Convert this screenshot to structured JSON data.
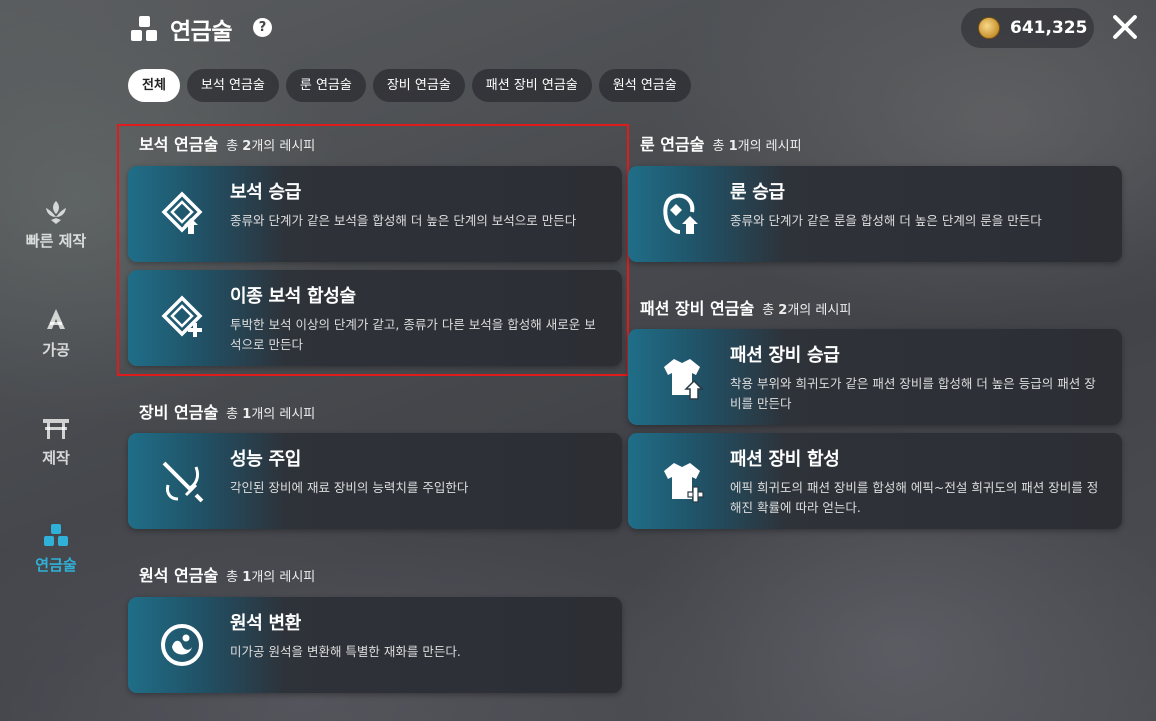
{
  "header": {
    "title": "연금술",
    "help": "?",
    "currency_value": "641,325"
  },
  "tabs": [
    {
      "label": "전체",
      "active": true
    },
    {
      "label": "보석 연금술"
    },
    {
      "label": "룬 연금술"
    },
    {
      "label": "장비 연금술"
    },
    {
      "label": "패션 장비 연금술"
    },
    {
      "label": "원석 연금술"
    }
  ],
  "sidebar": [
    {
      "label": "빠른 제작",
      "icon": "lotus-icon"
    },
    {
      "label": "가공",
      "icon": "anvil-icon"
    },
    {
      "label": "제작",
      "icon": "workbench-icon"
    },
    {
      "label": "연금술",
      "icon": "alchemy-icon",
      "active": true
    }
  ],
  "sections": {
    "gem": {
      "title": "보석 연금술",
      "count_prefix": "총",
      "count_num": "2",
      "count_suffix": "개의 레시피",
      "cards": [
        {
          "title": "보석 승급",
          "desc": "종류와 단계가 같은 보석을 합성해 더 높은 단계의 보석으로 만든다",
          "icon": "gem-upgrade-icon"
        },
        {
          "title": "이종 보석 합성술",
          "desc": "투박한 보석 이상의 단계가 같고, 종류가 다른 보석을 합성해 새로운 보석으로 만든다",
          "icon": "gem-combine-icon"
        }
      ]
    },
    "rune": {
      "title": "룬 연금술",
      "count_prefix": "총",
      "count_num": "1",
      "count_suffix": "개의 레시피",
      "cards": [
        {
          "title": "룬 승급",
          "desc": "종류와 단계가 같은 룬을 합성해 더 높은 단계의 룬을 만든다",
          "icon": "rune-upgrade-icon"
        }
      ]
    },
    "fashion": {
      "title": "패션 장비 연금술",
      "count_prefix": "총",
      "count_num": "2",
      "count_suffix": "개의 레시피",
      "cards": [
        {
          "title": "패션 장비 승급",
          "desc": "착용 부위와 희귀도가 같은 패션 장비를 합성해 더 높은 등급의 패션 장비를 만든다",
          "icon": "fashion-upgrade-icon"
        },
        {
          "title": "패션 장비 합성",
          "desc": "에픽 희귀도의 패션 장비를 합성해 에픽~전설 희귀도의 패션 장비를 정해진 확률에 따라 얻는다.",
          "icon": "fashion-combine-icon"
        }
      ]
    },
    "equip": {
      "title": "장비 연금술",
      "count_prefix": "총",
      "count_num": "1",
      "count_suffix": "개의 레시피",
      "cards": [
        {
          "title": "성능 주입",
          "desc": "각인된 장비에 재료 장비의 능력치를 주입한다",
          "icon": "sword-inject-icon"
        }
      ]
    },
    "ore": {
      "title": "원석 연금술",
      "count_prefix": "총",
      "count_num": "1",
      "count_suffix": "개의 레시피",
      "cards": [
        {
          "title": "원석 변환",
          "desc": "미가공 원석을 변환해 특별한 재화를 만든다.",
          "icon": "ore-convert-icon"
        }
      ]
    }
  },
  "colors": {
    "accent": "#2fb1d8",
    "highlight": "#e01b1b"
  }
}
